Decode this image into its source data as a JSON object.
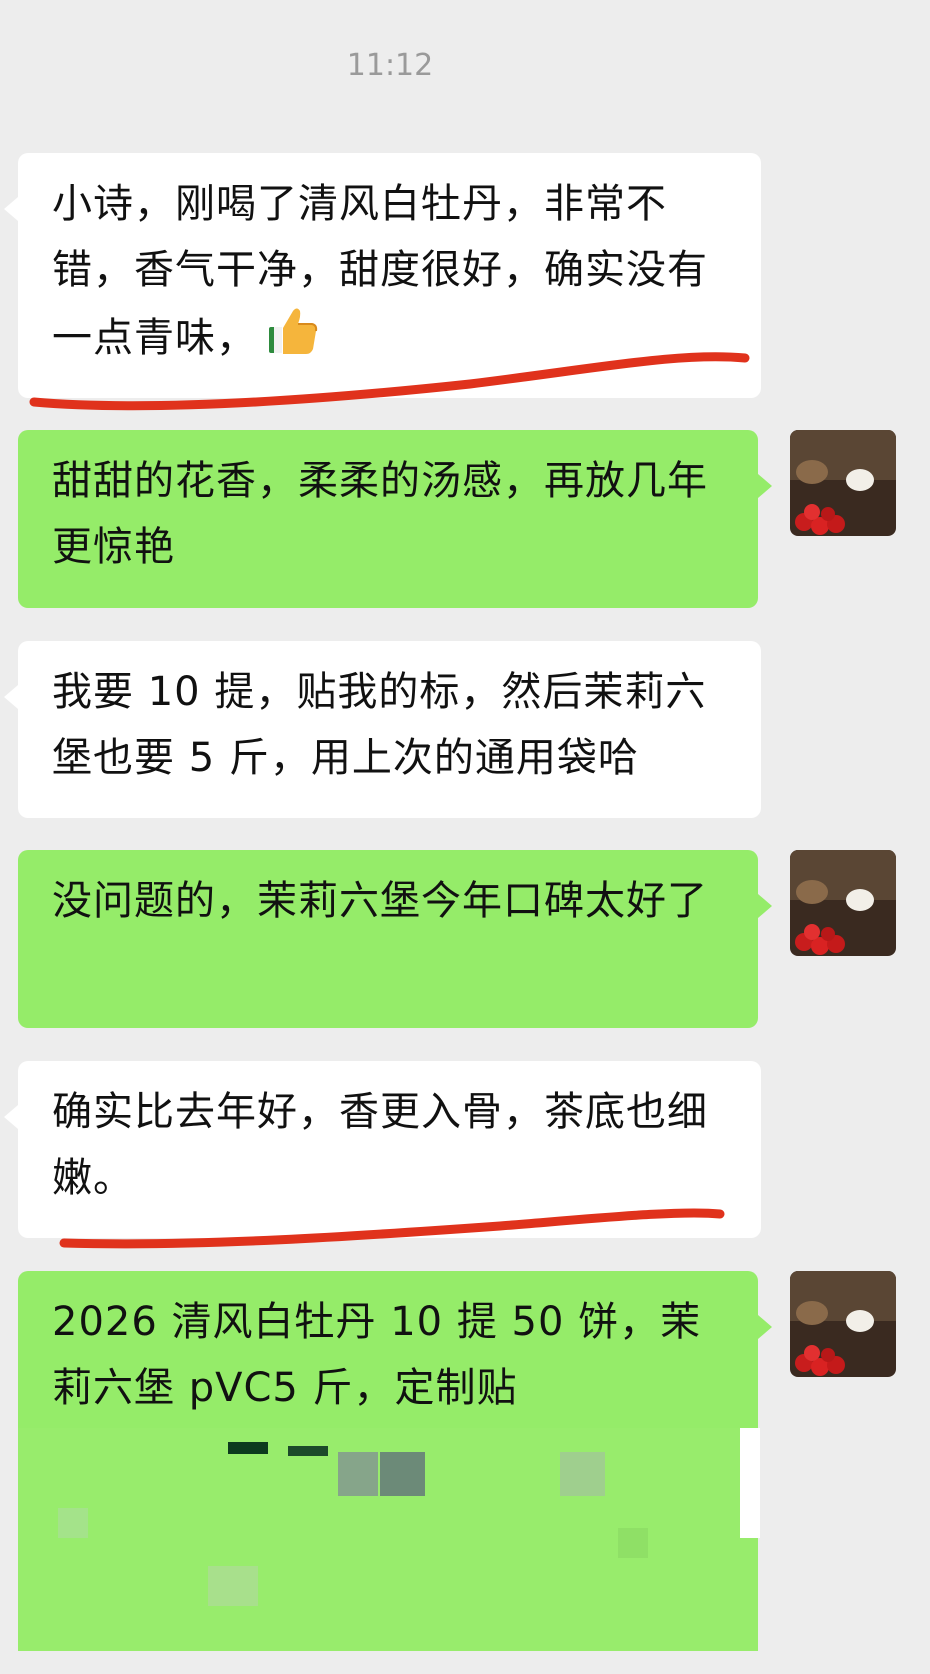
{
  "timestamp": "11:12",
  "messages": [
    {
      "from": "other",
      "text": "小诗，刚喝了清风白牡丹，非常不错，香气干净，甜度很好，确实没有一点青味，",
      "emoji": "thumbs-up-icon"
    },
    {
      "from": "me",
      "text": "甜甜的花香，柔柔的汤感，再放几年更惊艳"
    },
    {
      "from": "other",
      "text": "我要 10 提，贴我的标，然后茉莉六堡也要 5 斤，用上次的通用袋哈"
    },
    {
      "from": "me",
      "text": "没问题的，茉莉六堡今年口碑太好了"
    },
    {
      "from": "other",
      "text": "确实比去年好，香更入骨，茶底也细嫩。"
    },
    {
      "from": "me",
      "text": "2026 清风白牡丹 10 提 50 饼，茉莉六堡 pVC5 斤，定制贴"
    }
  ],
  "colors": {
    "background": "#ededed",
    "incoming_bubble": "#ffffff",
    "outgoing_bubble": "#95ec69",
    "annotation_line": "#e0321c"
  }
}
